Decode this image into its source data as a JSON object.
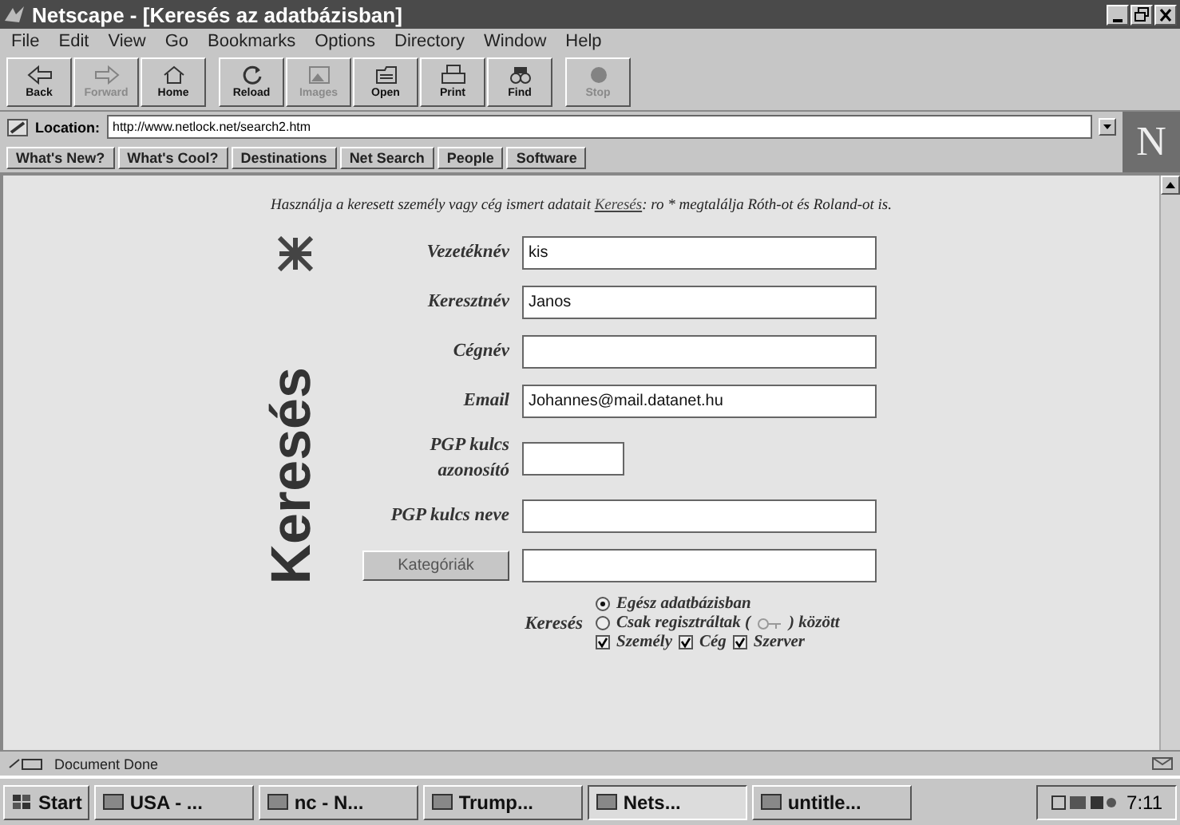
{
  "window": {
    "title": "Netscape - [Keresés az adatbázisban]"
  },
  "menu": [
    "File",
    "Edit",
    "View",
    "Go",
    "Bookmarks",
    "Options",
    "Directory",
    "Window",
    "Help"
  ],
  "toolbar": [
    {
      "label": "Back",
      "disabled": false
    },
    {
      "label": "Forward",
      "disabled": true
    },
    {
      "label": "Home",
      "disabled": false
    },
    {
      "label": "Reload",
      "disabled": false
    },
    {
      "label": "Images",
      "disabled": true
    },
    {
      "label": "Open",
      "disabled": false
    },
    {
      "label": "Print",
      "disabled": false
    },
    {
      "label": "Find",
      "disabled": false
    },
    {
      "label": "Stop",
      "disabled": true
    }
  ],
  "location": {
    "label": "Location:",
    "value": "http://www.netlock.net/search2.htm"
  },
  "brand": "N",
  "directory_buttons": [
    "What's New?",
    "What's Cool?",
    "Destinations",
    "Net Search",
    "People",
    "Software"
  ],
  "page": {
    "intro": {
      "before": "Használja a keresett személy vagy cég ismert adatait",
      "link": "Keresés",
      "after": ": ro * megtalálja Róth-ot és Roland-ot is."
    },
    "logo": "Keresés",
    "fields": [
      {
        "kind": "text",
        "label": "Vezetéknév",
        "value": "kis"
      },
      {
        "kind": "text",
        "label": "Keresztnév",
        "value": "Janos"
      },
      {
        "kind": "text",
        "label": "Cégnév"
      },
      {
        "kind": "text",
        "label": "Email",
        "value": "Johannes@mail.datanet.hu"
      },
      {
        "kind": "short",
        "label": "PGP kulcs azonosító"
      },
      {
        "kind": "text",
        "label": "PGP kulcs neve"
      },
      {
        "kind": "button",
        "label": "Kategóriák"
      }
    ],
    "scope": {
      "label": "Keresés",
      "options": [
        {
          "label": "Egész adatbázisban",
          "selected": true
        },
        {
          "label": "Csak regisztráltak (",
          "label_after": ") között",
          "selected": false
        }
      ],
      "types": [
        {
          "label": "Személy",
          "checked": true
        },
        {
          "label": "Cég",
          "checked": true
        },
        {
          "label": "Szerver",
          "checked": true
        }
      ]
    }
  },
  "status_bar": {
    "text": "Document Done"
  },
  "taskbar": {
    "start": "Start",
    "tasks": [
      {
        "label": "USA - ...",
        "selected": false
      },
      {
        "label": "nc - N...",
        "selected": false
      },
      {
        "label": "Trump...",
        "selected": false
      },
      {
        "label": "Nets...",
        "selected": true
      },
      {
        "label": "untitle...",
        "selected": false
      }
    ],
    "clock": "7:11"
  }
}
